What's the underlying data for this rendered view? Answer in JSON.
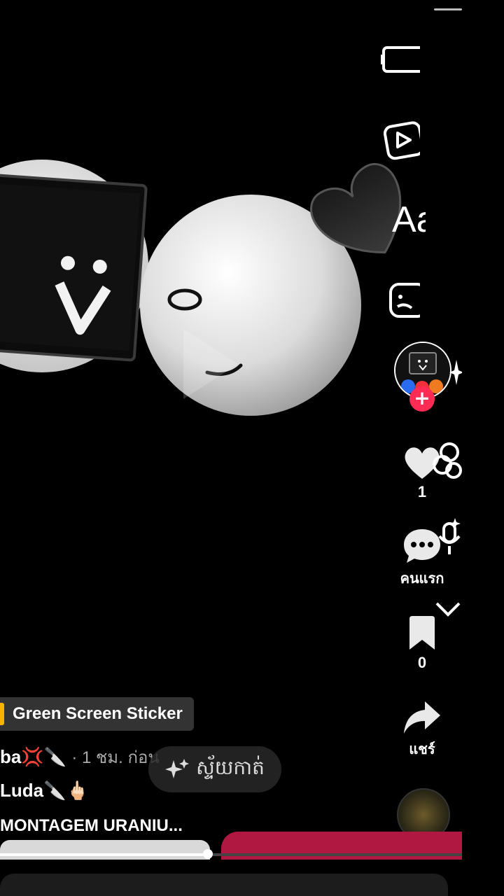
{
  "actions": {
    "like_count": "1",
    "comment_label": "คนแรก",
    "save_count": "0",
    "share_label": "แชร์"
  },
  "tools": {
    "text_tool": "Aa"
  },
  "caption": {
    "effect_label": "Green Screen Sticker",
    "line1_user": "ba",
    "line1_emojis": "💢🔪",
    "line1_time": "· 1 ชม. ก่อน",
    "line2_user": "Luda",
    "line2_emojis": "🔪🖕🏻",
    "music_text": "MONTAGEM URANIU..."
  },
  "scene_button": {
    "label": "ស្ទ័យកាត់"
  },
  "playback": {
    "progress": 0.45
  },
  "colors": {
    "accent": "#fe2c55",
    "effect_accent": "#f5b400",
    "cta": "#b01842"
  }
}
